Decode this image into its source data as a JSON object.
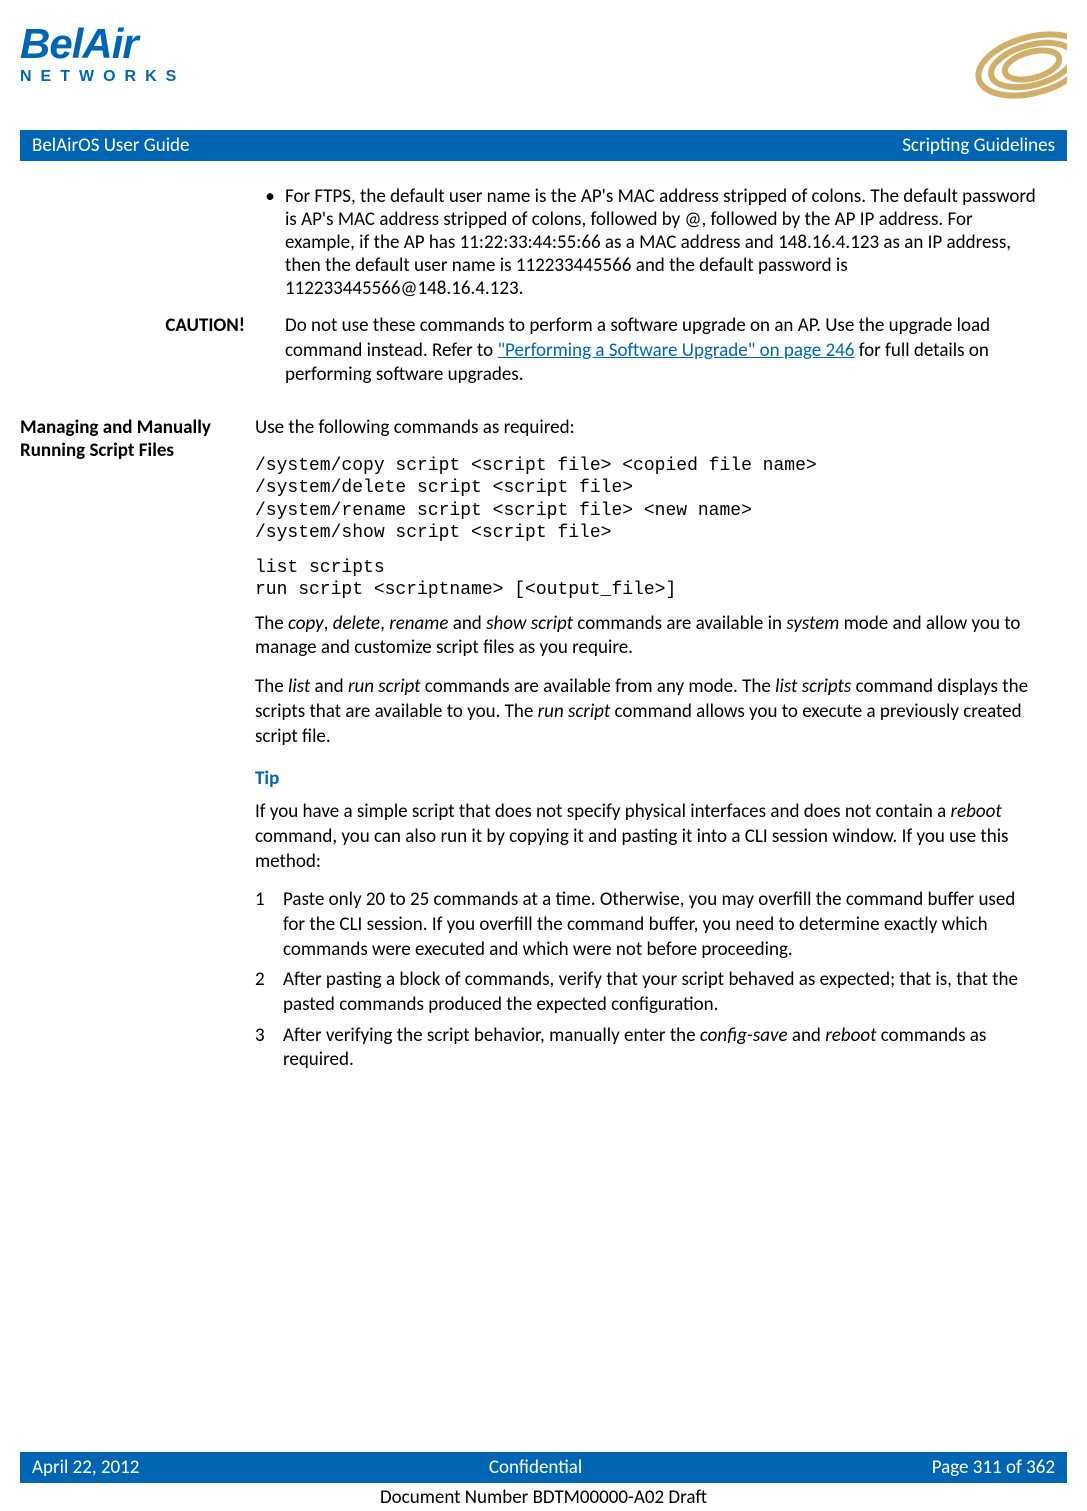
{
  "header": {
    "logo_top": "BelAir",
    "logo_bottom": "NETWORKS",
    "title_left": "BelAirOS User Guide",
    "title_right": "Scripting Guidelines"
  },
  "bullet": {
    "marker": "•",
    "text": "For FTPS, the default user name is the AP's MAC address stripped of colons. The default password is AP's MAC address stripped of colons, followed by @, followed by the AP IP address. For example, if the AP has 11:22:33:44:55:66 as a MAC address and 148.16.4.123 as an IP address, then the default user name is 112233445566 and the default password is 112233445566@148.16.4.123."
  },
  "caution": {
    "label": "CAUTION!",
    "text_before_link": "Do not use these commands to perform a software upgrade on an AP. Use the upgrade load command instead. Refer to ",
    "link_text": "\"Performing a Software Upgrade\" on page 246",
    "text_after_link": " for full details on performing software upgrades."
  },
  "section": {
    "heading": "Managing and Manually Running Script Files",
    "intro": "Use the following commands as required:",
    "code1": "/system/copy script <script file> <copied file name>\n/system/delete script <script file>\n/system/rename script <script file> <new name>\n/system/show script <script file>",
    "code2": "list scripts\nrun script <scriptname> [<output_file>]",
    "para1_pre": "The ",
    "para1_i1": "copy",
    "para1_s1": ", ",
    "para1_i2": "delete",
    "para1_s2": ", ",
    "para1_i3": "rename",
    "para1_s3": " and ",
    "para1_i4": "show script",
    "para1_s4": " commands are available in ",
    "para1_i5": "system",
    "para1_post": " mode and allow you to manage and customize script files as you require.",
    "para2_pre": "The ",
    "para2_i1": "list",
    "para2_s1": " and ",
    "para2_i2": "run script",
    "para2_s2": " commands are available from any mode. The ",
    "para2_i3": "list scripts",
    "para2_s3": " command displays the scripts that are available to you. The ",
    "para2_i4": "run script",
    "para2_post": " command allows you to execute a previously created script file."
  },
  "tip": {
    "heading": "Tip",
    "intro_pre": "If you have a simple script that does not specify physical interfaces and does not contain a ",
    "intro_i": "reboot",
    "intro_post": " command, you can also run it by copying it and pasting it into a CLI session window. If you use this method:",
    "items": [
      {
        "n": "1",
        "text": "Paste only 20 to 25 commands at a time. Otherwise, you may overfill the command buffer used for the CLI session. If you overfill the command buffer, you need to determine exactly which commands were executed and which were not before proceeding."
      },
      {
        "n": "2",
        "text": "After pasting a block of commands, verify that your script behaved as expected; that is, that the pasted commands produced the expected configuration."
      }
    ],
    "item3_n": "3",
    "item3_pre": "After verifying the script behavior, manually enter the ",
    "item3_i1": "config-save",
    "item3_mid": " and ",
    "item3_i2": "reboot",
    "item3_post": " commands as required."
  },
  "footer": {
    "left": "April 22, 2012",
    "center": "Confidential",
    "right": "Page 311 of 362",
    "docnum": "Document Number BDTM00000-A02 Draft"
  }
}
